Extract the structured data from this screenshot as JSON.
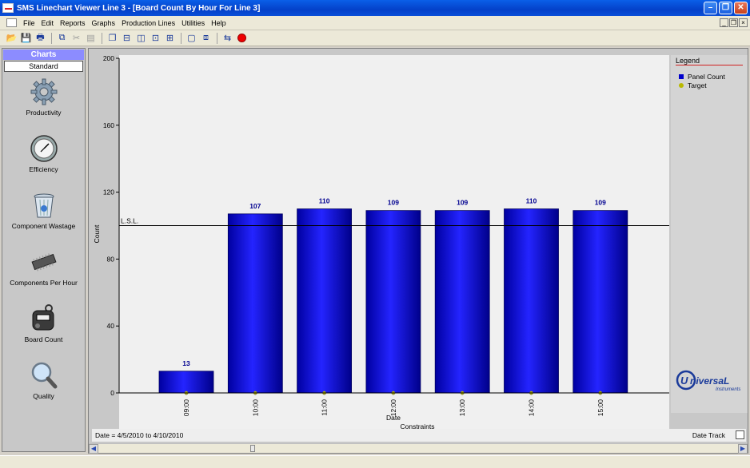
{
  "window": {
    "title": "SMS Linechart Viewer Line 3 - [Board Count By Hour For Line 3]"
  },
  "menu": [
    "File",
    "Edit",
    "Reports",
    "Graphs",
    "Production Lines",
    "Utilities",
    "Help"
  ],
  "toolbar": {
    "icons": [
      "open-icon",
      "save-icon",
      "print-icon",
      "copy-icon",
      "cut-icon",
      "paste-icon",
      "cascade-icon",
      "tile-horizontal-icon",
      "tile-vertical-icon",
      "arrange-icon",
      "grid-icon",
      "window-icon",
      "windows-icon",
      "refresh-icon",
      "record-icon"
    ]
  },
  "sidebar": {
    "title": "Charts",
    "subtitle": "Standard",
    "items": [
      {
        "label": "Productivity",
        "icon": "gear-icon"
      },
      {
        "label": "Efficiency",
        "icon": "clock-icon"
      },
      {
        "label": "Component Wastage",
        "icon": "trash-icon"
      },
      {
        "label": "Components Per Hour",
        "icon": "chip-icon"
      },
      {
        "label": "Board Count",
        "icon": "counter-icon"
      },
      {
        "label": "Quality",
        "icon": "magnifier-icon"
      }
    ]
  },
  "chart_data": {
    "type": "bar",
    "title": "",
    "xlabel": "Date",
    "xlabel2": "Constraints",
    "ylabel": "Count",
    "ylim": [
      0,
      200
    ],
    "yticks": [
      0,
      40,
      80,
      120,
      160,
      200
    ],
    "categories": [
      "09:00",
      "10:00",
      "11:00",
      "12:00",
      "13:00",
      "14:00",
      "15:00"
    ],
    "series": [
      {
        "name": "Panel Count",
        "color": "#0000cc",
        "values": [
          13,
          107,
          110,
          109,
          109,
          110,
          109
        ]
      },
      {
        "name": "Target",
        "color": "#b8b800",
        "values": [
          0,
          0,
          0,
          0,
          0,
          0,
          0
        ]
      }
    ],
    "reference_line": {
      "label": "L.S.L.",
      "value": 100
    },
    "data_labels": true,
    "grid": false,
    "legend_title": "Legend",
    "legend_position": "right"
  },
  "footer": {
    "date_range": "Date = 4/5/2010 to 4/10/2010",
    "date_track_label": "Date Track"
  },
  "logo": {
    "line1": "UniversaL",
    "line2": "Instruments"
  },
  "colors": {
    "bar": "#0000cc",
    "accent": "#8c8cff",
    "lsl_line": "#000000"
  }
}
